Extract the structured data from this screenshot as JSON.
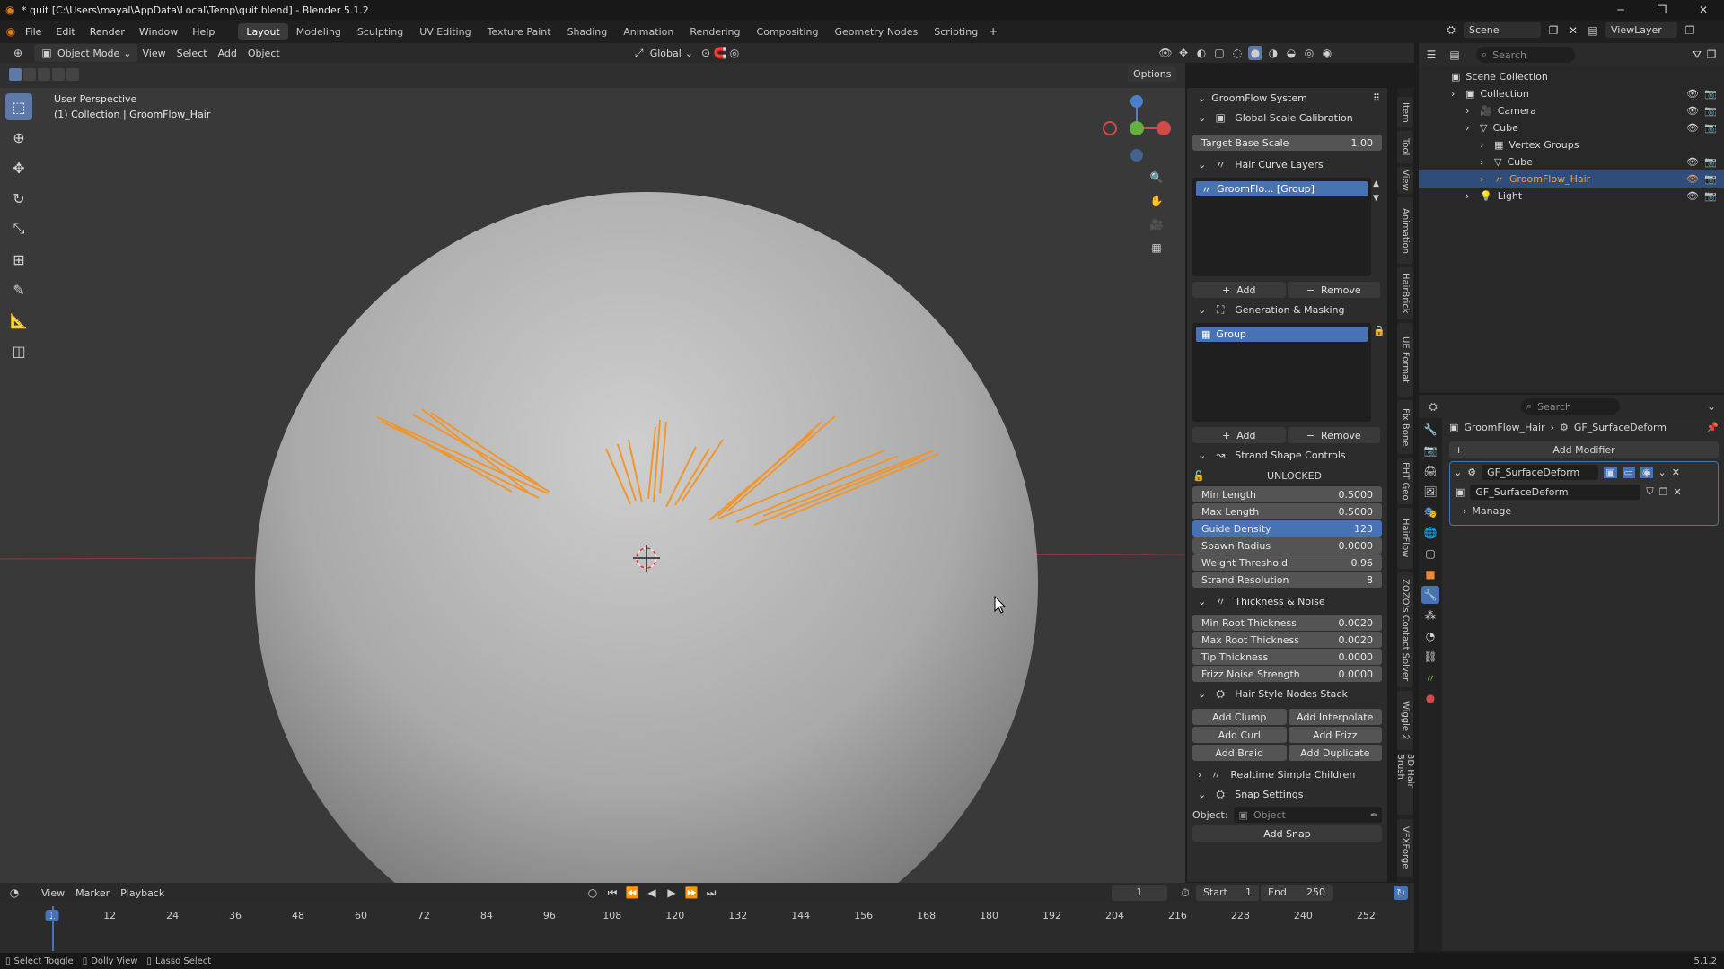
{
  "window": {
    "title": "* quit [C:\\Users\\mayal\\AppData\\Local\\Temp\\quit.blend] - Blender 5.1.2"
  },
  "menu": {
    "items": [
      "File",
      "Edit",
      "Render",
      "Window",
      "Help"
    ],
    "workspaces": [
      "Layout",
      "Modeling",
      "Sculpting",
      "UV Editing",
      "Texture Paint",
      "Shading",
      "Animation",
      "Rendering",
      "Compositing",
      "Geometry Nodes",
      "Scripting"
    ],
    "active_workspace": "Layout",
    "scene": "Scene",
    "view_layer": "ViewLayer"
  },
  "viewport": {
    "mode": "Object Mode",
    "menus": [
      "View",
      "Select",
      "Add",
      "Object"
    ],
    "transform_orientation": "Global",
    "options": "Options",
    "info_line1": "User Perspective",
    "info_line2": "(1) Collection | GroomFlow_Hair"
  },
  "npanel": {
    "title": "GroomFlow System",
    "global_scale": {
      "header": "Global Scale Calibration",
      "label": "Target Base Scale",
      "value": "1.00"
    },
    "hair_layers": {
      "header": "Hair Curve Layers",
      "item": "GroomFlo...  [Group]",
      "add": "Add",
      "remove": "Remove"
    },
    "gen_mask": {
      "header": "Generation & Masking",
      "item": "Group",
      "add": "Add",
      "remove": "Remove"
    },
    "strand": {
      "header": "Strand Shape Controls",
      "lock": "UNLOCKED",
      "rows": [
        {
          "label": "Min Length",
          "value": "0.5000"
        },
        {
          "label": "Max Length",
          "value": "0.5000"
        },
        {
          "label": "Guide Density",
          "value": "123"
        },
        {
          "label": "Spawn Radius",
          "value": "0.0000"
        },
        {
          "label": "Weight Threshold",
          "value": "0.96"
        },
        {
          "label": "Strand Resolution",
          "value": "8"
        }
      ]
    },
    "thickness": {
      "header": "Thickness & Noise",
      "rows": [
        {
          "label": "Min Root Thickness",
          "value": "0.0020"
        },
        {
          "label": "Max Root Thickness",
          "value": "0.0020"
        },
        {
          "label": "Tip Thickness",
          "value": "0.0000"
        },
        {
          "label": "Frizz Noise Strength",
          "value": "0.0000"
        }
      ]
    },
    "nodes": {
      "header": "Hair Style Nodes Stack",
      "buttons": [
        "Add Clump",
        "Add Interpolate",
        "Add Curl",
        "Add Frizz",
        "Add Braid",
        "Add Duplicate"
      ]
    },
    "realtime": "Realtime Simple Children",
    "snap": {
      "header": "Snap Settings",
      "object_label": "Object:",
      "object_placeholder": "Object",
      "add_snap": "Add Snap"
    }
  },
  "vtabs": [
    "Item",
    "Tool",
    "View",
    "Animation",
    "HairBrick",
    "UE Format",
    "Fix Bone",
    "FHT Geo",
    "HairFlow",
    "ZOZO's Contact Solver",
    "Wiggle 2",
    "3D Hair Brush",
    "VFXForge"
  ],
  "outliner": {
    "search": "Search",
    "root": "Scene Collection",
    "items": [
      {
        "name": "Collection",
        "indent": 1
      },
      {
        "name": "Camera",
        "indent": 2
      },
      {
        "name": "Cube",
        "indent": 2
      },
      {
        "name": "Vertex Groups",
        "indent": 3
      },
      {
        "name": "Cube",
        "indent": 3
      },
      {
        "name": "GroomFlow_Hair",
        "indent": 3
      },
      {
        "name": "Light",
        "indent": 2
      }
    ]
  },
  "properties": {
    "search": "Search",
    "crumb_object": "GroomFlow_Hair",
    "crumb_mod": "GF_SurfaceDeform",
    "add_modifier": "Add Modifier",
    "modifier_name": "GF_SurfaceDeform",
    "node_group": "GF_SurfaceDeform",
    "manage": "Manage"
  },
  "timeline": {
    "menus": [
      "View",
      "Marker",
      "Playback"
    ],
    "current_frame": "1",
    "start_label": "Start",
    "start": "1",
    "end_label": "End",
    "end": "250",
    "ticks": [
      "1",
      "12",
      "24",
      "36",
      "48",
      "60",
      "72",
      "84",
      "96",
      "108",
      "120",
      "132",
      "144",
      "156",
      "168",
      "180",
      "192",
      "204",
      "216",
      "228",
      "240",
      "252"
    ]
  },
  "status": {
    "select": "Select Toggle",
    "dolly": "Dolly View",
    "lasso": "Lasso Select",
    "version": "5.1.2"
  }
}
